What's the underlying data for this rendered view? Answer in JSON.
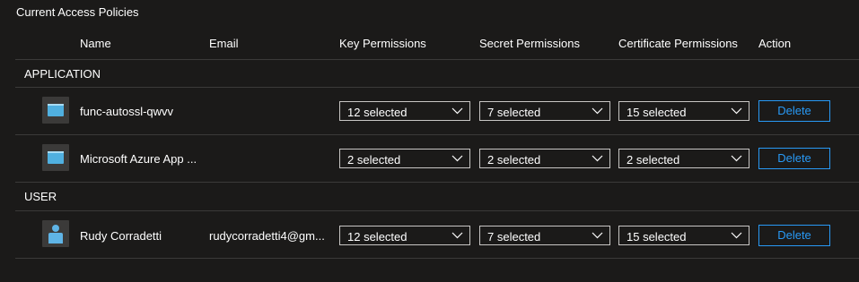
{
  "title": "Current Access Policies",
  "headers": {
    "name": "Name",
    "email": "Email",
    "key": "Key Permissions",
    "secret": "Secret Permissions",
    "certificate": "Certificate Permissions",
    "action": "Action"
  },
  "sections": {
    "application": "APPLICATION",
    "user": "USER"
  },
  "rows": [
    {
      "type": "application",
      "icon": "app-registration-icon",
      "name": "func-autossl-qwvv",
      "email": "",
      "key": "12 selected",
      "secret": "7 selected",
      "certificate": "15 selected",
      "action": "Delete"
    },
    {
      "type": "application",
      "icon": "app-registration-icon",
      "name": "Microsoft Azure App ...",
      "email": "",
      "key": "2 selected",
      "secret": "2 selected",
      "certificate": "2 selected",
      "action": "Delete"
    },
    {
      "type": "user",
      "icon": "user-icon",
      "name": "Rudy Corradetti",
      "email": "rudycorradetti4@gm...",
      "key": "12 selected",
      "secret": "7 selected",
      "certificate": "15 selected",
      "action": "Delete"
    }
  ],
  "colors": {
    "background": "#1b1a19",
    "accent": "#2899f5",
    "border": "#c8c6c4",
    "divider": "#3b3a39",
    "icon_blue": "#50b0e0"
  }
}
